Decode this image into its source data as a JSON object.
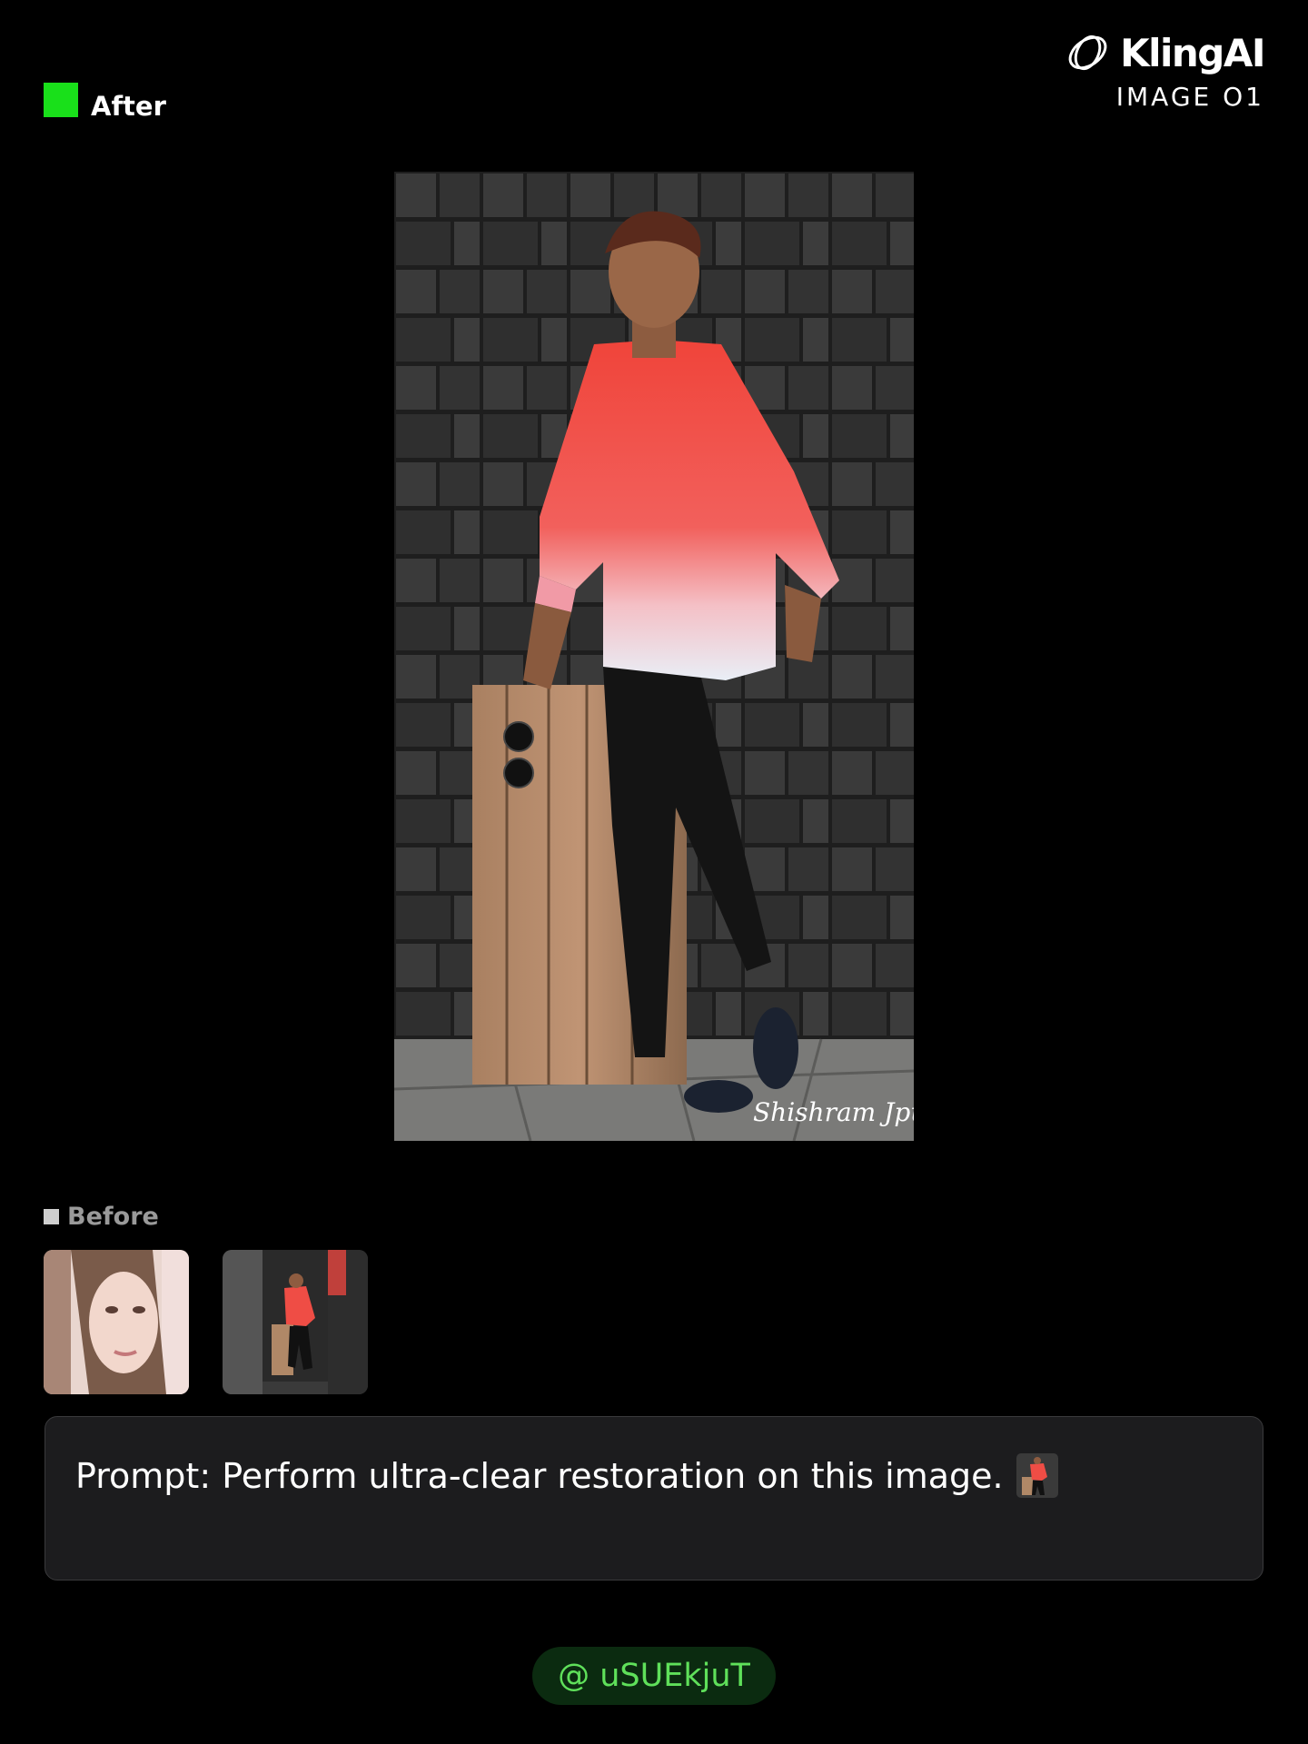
{
  "after_label": "After",
  "brand": {
    "name": "KlingAI",
    "product": "IMAGE O1"
  },
  "main_photo": {
    "watermark": "Shishram Jpur"
  },
  "before_label": "Before",
  "before_thumbnails": [
    {
      "name": "portrait-woman-thumbnail"
    },
    {
      "name": "man-red-shirt-thumbnail"
    }
  ],
  "prompt": {
    "text": "Prompt: Perform ultra-clear restoration on this image."
  },
  "user_tag": "@ uSUEkjuT",
  "colors": {
    "after_accent": "#19e01a",
    "user_tag_text": "#5fe05a",
    "user_tag_bg": "#0b2b10",
    "prompt_bg": "#1c1c1e"
  }
}
